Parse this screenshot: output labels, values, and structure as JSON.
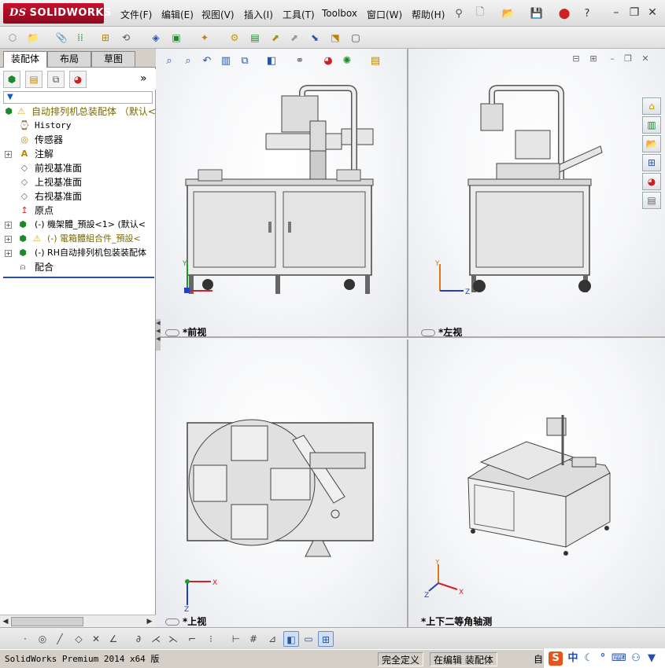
{
  "app": {
    "logo_prefix": "DS",
    "logo_text": "SOLIDWORKS"
  },
  "menu": {
    "items": [
      "文件(F)",
      "编辑(E)",
      "视图(V)",
      "插入(I)",
      "工具(T)",
      "Toolbox",
      "窗口(W)",
      "帮助(H)"
    ]
  },
  "panel": {
    "tabs": [
      "装配体",
      "布局",
      "草图"
    ],
    "expand_glyph": "»",
    "filter_glyph": "▼"
  },
  "tree": {
    "root": "自动排列机总装配体 （默认<",
    "items": [
      {
        "label": "History",
        "icon": "history-icon"
      },
      {
        "label": "传感器",
        "icon": "sensor-icon"
      },
      {
        "label": "注解",
        "icon": "annotation-icon"
      },
      {
        "label": "前视基准面",
        "icon": "plane-icon"
      },
      {
        "label": "上视基准面",
        "icon": "plane-icon"
      },
      {
        "label": "右视基准面",
        "icon": "plane-icon"
      },
      {
        "label": "原点",
        "icon": "origin-icon"
      },
      {
        "label": "(-) 機架體_預設<1> (默认<",
        "icon": "subassembly-icon"
      },
      {
        "label": "(-) 電箱體組合件_預設<",
        "icon": "subassembly-warning-icon"
      },
      {
        "label": "(-) RH自动排列机包装装配体",
        "icon": "subassembly-icon"
      },
      {
        "label": "配合",
        "icon": "mates-icon"
      }
    ]
  },
  "viewports": {
    "front": "*前视",
    "left": "*左视",
    "top": "*上视",
    "iso": "*上下二等角轴测"
  },
  "triad": {
    "x": "X",
    "y": "Y",
    "z": "Z"
  },
  "status": {
    "product": "SolidWorks Premium 2014 x64 版",
    "definition": "完全定义",
    "mode": "在编辑 装配体",
    "trail": "自"
  },
  "ime": {
    "logo": "S",
    "lang": "中"
  },
  "colors": {
    "logo_red": "#c8102e",
    "warning_yellow": "#f2c200",
    "tree_blue": "#2a4fa3",
    "triad_red": "#d0202a",
    "triad_green": "#1e9a2a",
    "triad_blue": "#2040c0"
  }
}
